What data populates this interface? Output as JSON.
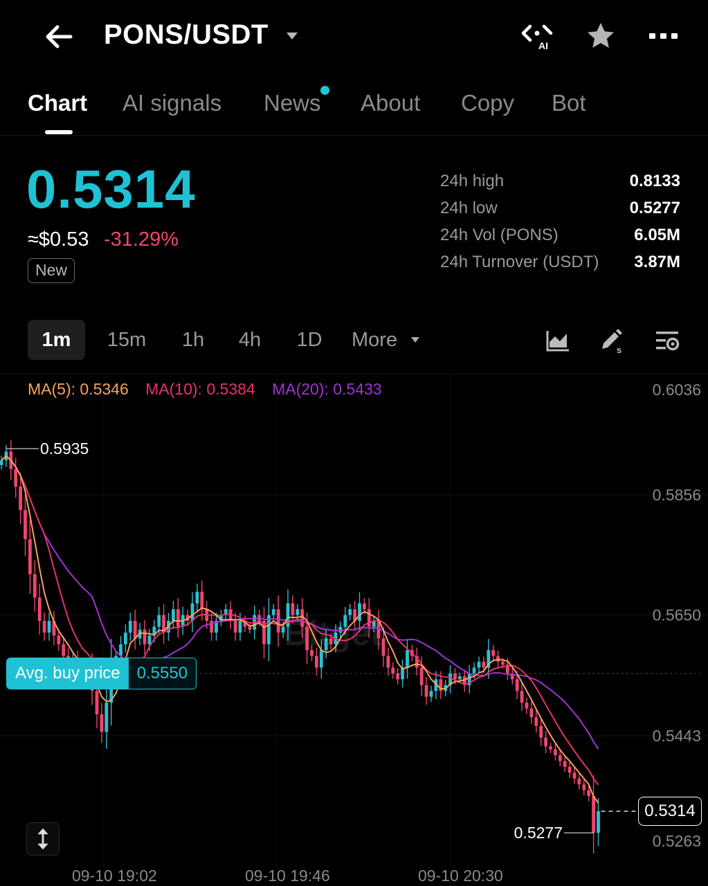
{
  "header": {
    "pair": "PONS/USDT",
    "ai_badge": "AI"
  },
  "tabs": [
    {
      "label": "Chart",
      "active": true
    },
    {
      "label": "AI signals",
      "active": false
    },
    {
      "label": "News",
      "active": false,
      "has_dot": true
    },
    {
      "label": "About",
      "active": false
    },
    {
      "label": "Copy",
      "active": false
    },
    {
      "label": "Bot",
      "active": false
    }
  ],
  "price": {
    "last": "0.5314",
    "usd": "≈$0.53",
    "change_pct": "-31.29%",
    "badge": "New"
  },
  "stats": [
    {
      "label": "24h high",
      "value": "0.8133"
    },
    {
      "label": "24h low",
      "value": "0.5277"
    },
    {
      "label": "24h Vol (PONS)",
      "value": "6.05M"
    },
    {
      "label": "24h Turnover (USDT)",
      "value": "3.87M"
    }
  ],
  "timeframes": [
    {
      "label": "1m",
      "active": true
    },
    {
      "label": "15m",
      "active": false
    },
    {
      "label": "1h",
      "active": false
    },
    {
      "label": "4h",
      "active": false
    },
    {
      "label": "1D",
      "active": false
    },
    {
      "label": "More",
      "active": false
    }
  ],
  "toolbar_icons": [
    "chart-type-icon",
    "draw-tools-icon",
    "indicator-settings-icon"
  ],
  "colors": {
    "accent": "#1fc2d4",
    "up": "#2ebfd2",
    "down": "#ef4570",
    "ma5": "#f7a35c",
    "ma10": "#e8316d",
    "ma20": "#a233d6"
  },
  "chart_data": {
    "type": "candlestick",
    "interval": "1m",
    "ma": [
      {
        "name": "MA(5)",
        "label": "MA(5): 0.5346",
        "value": 0.5346
      },
      {
        "name": "MA(10)",
        "label": "MA(10): 0.5384",
        "value": 0.5384
      },
      {
        "name": "MA(20)",
        "label": "MA(20): 0.5433",
        "value": 0.5433
      }
    ],
    "y_ticks": [
      "0.6036",
      "0.5856",
      "0.5650",
      "0.5443",
      "0.5263"
    ],
    "ylim": [
      0.5263,
      0.6036
    ],
    "x_ticks": [
      "09-10 19:02",
      "09-10 19:46",
      "09-10 20:30"
    ],
    "high_marker": "0.5935",
    "low_marker": "0.5277",
    "avg_buy_label": "Avg. buy price",
    "avg_buy_price": "0.5550",
    "last_price": "0.5314",
    "watermark": "Bitget",
    "closes": [
      0.5915,
      0.593,
      0.59,
      0.587,
      0.583,
      0.578,
      0.572,
      0.568,
      0.564,
      0.562,
      0.564,
      0.5615,
      0.56,
      0.558,
      0.556,
      0.5575,
      0.5555,
      0.554,
      0.556,
      0.552,
      0.548,
      0.545,
      0.55,
      0.557,
      0.558,
      0.56,
      0.562,
      0.564,
      0.561,
      0.5625,
      0.56,
      0.5615,
      0.563,
      0.565,
      0.562,
      0.564,
      0.566,
      0.563,
      0.565,
      0.564,
      0.567,
      0.569,
      0.566,
      0.564,
      0.562,
      0.564,
      0.565,
      0.566,
      0.564,
      0.562,
      0.564,
      0.563,
      0.5625,
      0.565,
      0.564,
      0.56,
      0.565,
      0.566,
      0.562,
      0.563,
      0.567,
      0.565,
      0.566,
      0.563,
      0.559,
      0.558,
      0.556,
      0.559,
      0.561,
      0.56,
      0.562,
      0.563,
      0.565,
      0.566,
      0.564,
      0.567,
      0.566,
      0.563,
      0.564,
      0.561,
      0.558,
      0.556,
      0.555,
      0.554,
      0.556,
      0.559,
      0.558,
      0.556,
      0.553,
      0.551,
      0.552,
      0.554,
      0.552,
      0.553,
      0.555,
      0.554,
      0.5545,
      0.553,
      0.555,
      0.556,
      0.557,
      0.556,
      0.559,
      0.558,
      0.557,
      0.5565,
      0.555,
      0.554,
      0.552,
      0.55,
      0.549,
      0.5475,
      0.546,
      0.544,
      0.5425,
      0.542,
      0.541,
      0.54,
      0.539,
      0.538,
      0.537,
      0.536,
      0.535,
      0.534,
      0.5277,
      0.5314
    ]
  }
}
